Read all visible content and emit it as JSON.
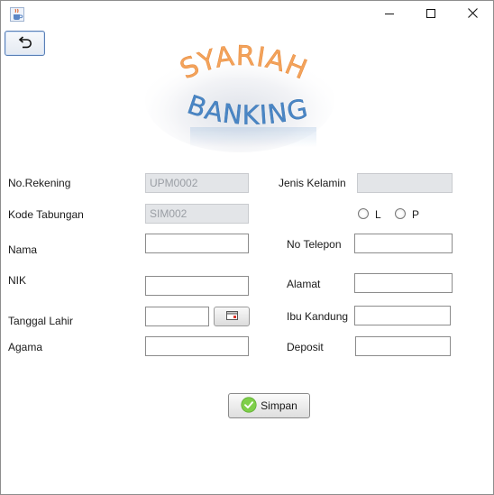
{
  "window": {
    "app_icon": "java-cup-icon",
    "controls": {
      "minimize": "minimize-icon",
      "maximize": "maximize-icon",
      "close": "close-icon"
    }
  },
  "toolbar": {
    "back_icon": "undo-arrow-icon"
  },
  "logo": {
    "line1": "SYARIAH",
    "line2": "BANKING",
    "color_orange": "#f0a055",
    "color_blue": "#4a86c5"
  },
  "form": {
    "no_rekening": {
      "label": "No.Rekening",
      "value": "UPM0002"
    },
    "kode_tabungan": {
      "label": "Kode Tabungan",
      "value": "SIM002"
    },
    "nama": {
      "label": "Nama",
      "value": ""
    },
    "nik": {
      "label": "NIK",
      "value": ""
    },
    "tanggal_lahir": {
      "label": "Tanggal Lahir",
      "value": "",
      "button_icon": "calendar-icon"
    },
    "agama": {
      "label": "Agama",
      "value": ""
    },
    "jenis_kelamin": {
      "label": "Jenis Kelamin",
      "value": "",
      "options": [
        "L",
        "P"
      ]
    },
    "no_telepon": {
      "label": "No Telepon",
      "value": ""
    },
    "alamat": {
      "label": "Alamat",
      "value": ""
    },
    "ibu_kandung": {
      "label": "Ibu Kandung",
      "value": ""
    },
    "deposit": {
      "label": "Deposit",
      "value": ""
    }
  },
  "actions": {
    "simpan_label": "Simpan",
    "simpan_icon": "check-circle-icon"
  }
}
